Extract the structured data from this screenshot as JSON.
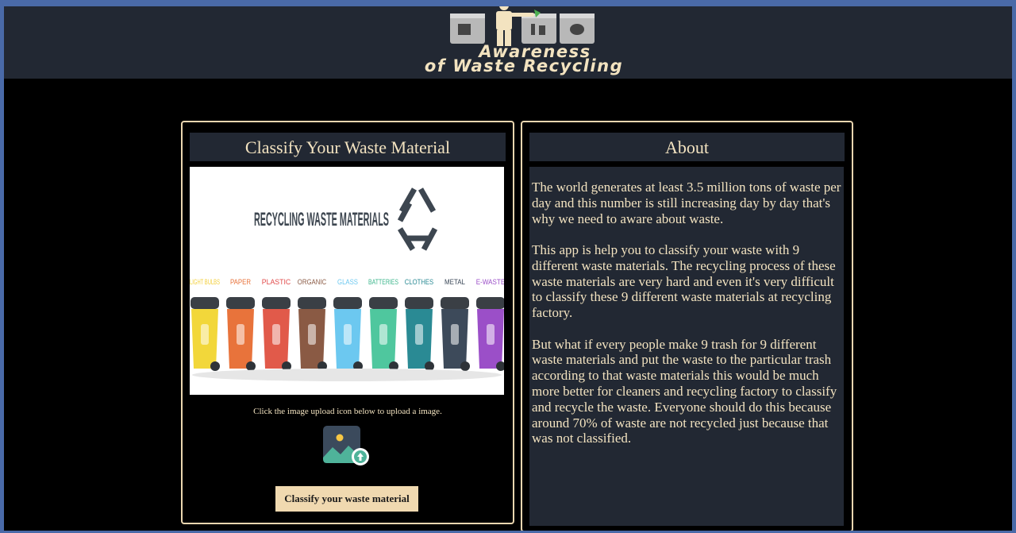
{
  "header": {
    "logo_line1": "Awareness",
    "logo_line2": "of Waste Recycling"
  },
  "classify_card": {
    "title": "Classify Your Waste Material",
    "hero": {
      "heading": "RECYCLING WASTE MATERIALS",
      "bins": [
        {
          "label": "LIGHT BULBS",
          "color": "#f2d73a",
          "label_color": "#f2cf3a"
        },
        {
          "label": "PAPER",
          "color": "#e8733b",
          "label_color": "#e8733b"
        },
        {
          "label": "PLASTIC",
          "color": "#e15a4a",
          "label_color": "#e14a4a"
        },
        {
          "label": "ORGANIC",
          "color": "#8a5a44",
          "label_color": "#8a5a44"
        },
        {
          "label": "GLASS",
          "color": "#6cc8f0",
          "label_color": "#6cc8f0"
        },
        {
          "label": "BATTERIES",
          "color": "#4fc79e",
          "label_color": "#3fb78e"
        },
        {
          "label": "CLOTHES",
          "color": "#2a8a94",
          "label_color": "#2a8a94"
        },
        {
          "label": "METAL",
          "color": "#3d4a5a",
          "label_color": "#3d4a5a"
        },
        {
          "label": "E-WASTE",
          "color": "#9b4fc8",
          "label_color": "#9b4fc8"
        }
      ]
    },
    "hint": "Click the image upload icon below to upload a image.",
    "button_label": "Classify your waste material"
  },
  "about_card": {
    "title": "About",
    "paragraphs": [
      "The world generates at least 3.5 million tons of waste per day and this number is still increasing day by day that's why we need to aware about waste.",
      "This app is help you to classify your waste with 9 different waste materials. The recycling process of these waste materials are very hard and even it's very difficult to classify these 9 different waste materials at recycling factory.",
      "But what if every people make 9 trash for 9 different waste materials and put the waste to the particular trash according to that waste materials this would be much more better for cleaners and recycling factory to classify and recycle the waste. Everyone should do this because around 70% of waste are not recycled just because that was not classified."
    ]
  },
  "colors": {
    "accent": "#f3e3c0",
    "panel": "#222833",
    "button": "#f0d9b0"
  }
}
